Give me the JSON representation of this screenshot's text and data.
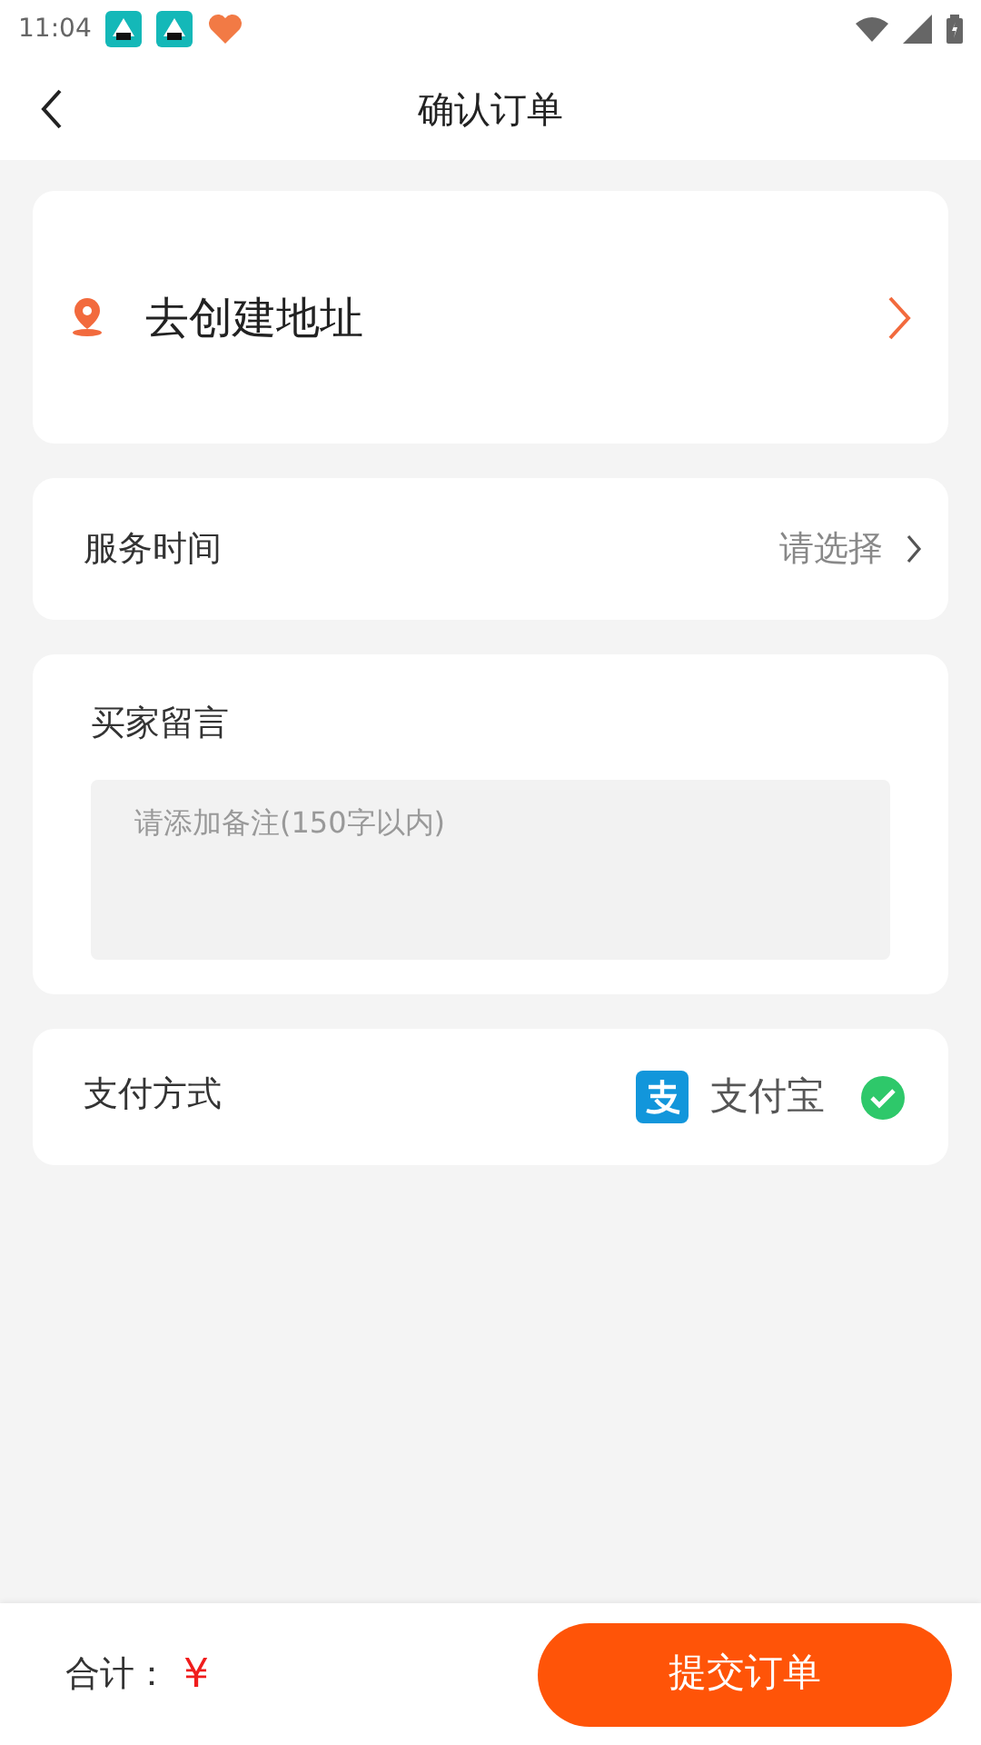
{
  "status_bar": {
    "time": "11:04"
  },
  "header": {
    "title": "确认订单"
  },
  "address": {
    "label": "去创建地址"
  },
  "service_time": {
    "label": "服务时间",
    "value": "请选择"
  },
  "message": {
    "label": "买家留言",
    "placeholder": "请添加备注(150字以内)"
  },
  "payment": {
    "label": "支付方式",
    "method": "支付宝",
    "checked": true
  },
  "footer": {
    "total_label": "合计：",
    "currency": "¥",
    "submit": "提交订单"
  }
}
